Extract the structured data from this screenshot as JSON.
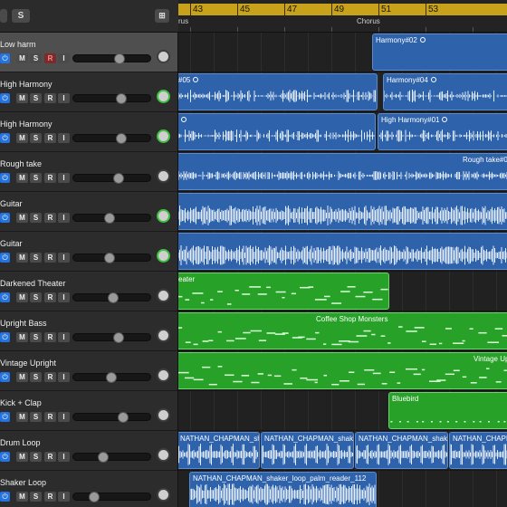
{
  "toolbar": {
    "solo_label": "S"
  },
  "ruler": {
    "bars": [
      "43",
      "45",
      "47",
      "49",
      "51",
      "53"
    ],
    "markers": [
      "rus",
      "Chorus"
    ]
  },
  "tracks": [
    {
      "name": "Low harm",
      "fader": 0.6,
      "pan": "neutral",
      "selected": true,
      "record": true
    },
    {
      "name": "High Harmony",
      "fader": 0.62,
      "pan": "green",
      "selected": false,
      "record": false
    },
    {
      "name": "High Harmony",
      "fader": 0.62,
      "pan": "green",
      "selected": false,
      "record": false
    },
    {
      "name": "Rough take",
      "fader": 0.58,
      "pan": "neutral",
      "selected": false,
      "record": false
    },
    {
      "name": "Guitar",
      "fader": 0.45,
      "pan": "green",
      "selected": false,
      "record": false
    },
    {
      "name": "Guitar",
      "fader": 0.45,
      "pan": "green",
      "selected": false,
      "record": false
    },
    {
      "name": "Darkened Theater",
      "fader": 0.5,
      "pan": "neutral",
      "selected": false,
      "record": false
    },
    {
      "name": "Upright Bass",
      "fader": 0.58,
      "pan": "neutral",
      "selected": false,
      "record": false
    },
    {
      "name": "Vintage Upright",
      "fader": 0.48,
      "pan": "neutral",
      "selected": false,
      "record": false
    },
    {
      "name": "Kick + Clap",
      "fader": 0.65,
      "pan": "neutral",
      "selected": false,
      "record": false
    },
    {
      "name": "Drum Loop",
      "fader": 0.36,
      "pan": "neutral",
      "selected": false,
      "record": false
    },
    {
      "name": "Shaker Loop",
      "fader": 0.23,
      "pan": "neutral",
      "selected": false,
      "record": false
    }
  ],
  "track_buttons": {
    "mute": "M",
    "solo": "S",
    "record": "R",
    "input": "I"
  },
  "regions": [
    {
      "name": "Harmony#02",
      "kind": "audio",
      "loop": true
    },
    {
      "name": "#05",
      "kind": "audio",
      "loop": true
    },
    {
      "name": "Harmony#04",
      "kind": "audio",
      "loop": true
    },
    {
      "name": "",
      "kind": "audio",
      "loop": true
    },
    {
      "name": "High Harmony#01",
      "kind": "audio",
      "loop": true
    },
    {
      "name": "Rough take#0",
      "kind": "audio",
      "loop": false
    },
    {
      "name": "",
      "kind": "audio",
      "loop": false
    },
    {
      "name": "",
      "kind": "audio",
      "loop": false
    },
    {
      "name": "eater",
      "kind": "midi",
      "loop": false
    },
    {
      "name": "Coffee Shop Monsters",
      "kind": "midi",
      "loop": false
    },
    {
      "name": "Vintage Up",
      "kind": "midi",
      "loop": false
    },
    {
      "name": "Bluebird",
      "kind": "midi",
      "loop": false
    },
    {
      "name": "NATHAN_CHAPMAN_shake",
      "kind": "audio",
      "loop": false
    },
    {
      "name": "NATHAN_CHAPMAN_shake",
      "kind": "audio",
      "loop": false
    },
    {
      "name": "NATHAN_CHAPMAN_shake",
      "kind": "audio",
      "loop": false
    },
    {
      "name": "NATHAN_CHAPMAN_shake",
      "kind": "audio",
      "loop": false
    },
    {
      "name": "NATHAN_CHAPMAN_shaker_loop_palm_reader_112",
      "kind": "audio",
      "loop": false
    }
  ],
  "colors": {
    "audio": "#2e62aa",
    "midi": "#28a128",
    "cycle": "#c8a21a",
    "power": "#2473e0"
  }
}
